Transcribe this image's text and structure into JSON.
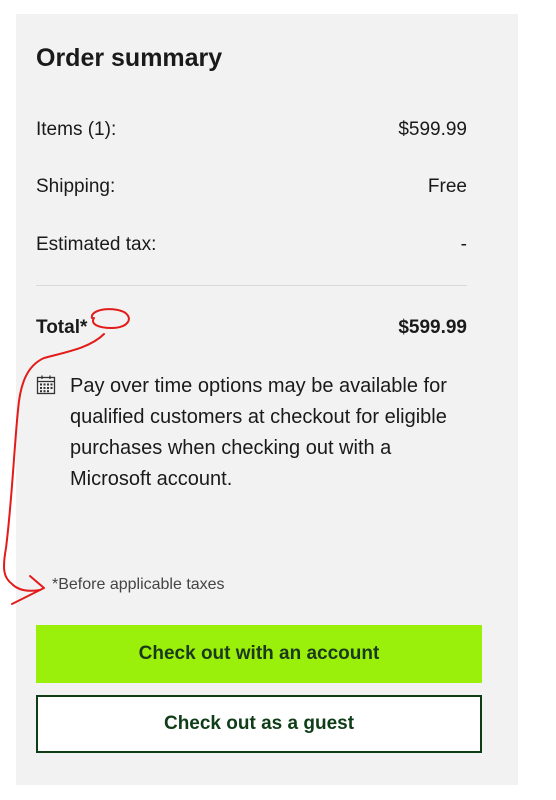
{
  "summary": {
    "title": "Order summary",
    "items_label": "Items (1):",
    "items_value": "$599.99",
    "shipping_label": "Shipping:",
    "shipping_value": "Free",
    "tax_label": "Estimated tax:",
    "tax_value": "-",
    "total_label": "Total*",
    "total_value": "$599.99",
    "pay_note": "Pay over time options may be available for qualified customers at checkout for eligible purchases when checking out with a Microsoft account.",
    "pay_note_icon": "calendar-icon",
    "footnote": "*Before applicable taxes"
  },
  "buttons": {
    "account_label": "Check out with an account",
    "guest_label": "Check out as a guest"
  },
  "colors": {
    "panel_bg": "#f2f2f2",
    "primary_button": "#9bf00b",
    "secondary_border": "#0f3d17",
    "annotation": "#e21b1b"
  }
}
